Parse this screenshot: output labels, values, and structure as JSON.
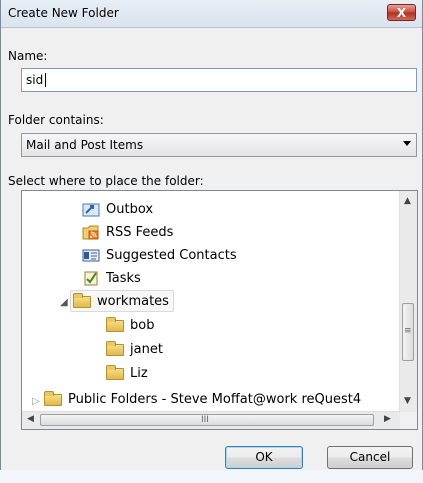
{
  "dialog": {
    "title": "Create New Folder",
    "close_label": "X",
    "name_label": "Name:",
    "name_value": "sid",
    "contains_label": "Folder contains:",
    "contains_value": "Mail and Post Items",
    "place_label": "Select where to place the folder:",
    "ok_label": "OK",
    "cancel_label": "Cancel"
  },
  "tree": {
    "items": [
      {
        "label": "Outbox",
        "icon": "outbox-icon"
      },
      {
        "label": "RSS Feeds",
        "icon": "rss-icon"
      },
      {
        "label": "Suggested Contacts",
        "icon": "contacts-icon"
      },
      {
        "label": "Tasks",
        "icon": "tasks-icon"
      },
      {
        "label": "workmates",
        "icon": "folder-icon",
        "expanded": true
      },
      {
        "label": "bob",
        "icon": "folder-icon"
      },
      {
        "label": "janet",
        "icon": "folder-icon"
      },
      {
        "label": "Liz",
        "icon": "folder-icon"
      },
      {
        "label": "Public Folders - Steve Moffat@work reQuest4",
        "icon": "public-folders-icon",
        "expanded": false
      }
    ],
    "hscroll_thumb_label": "III"
  }
}
